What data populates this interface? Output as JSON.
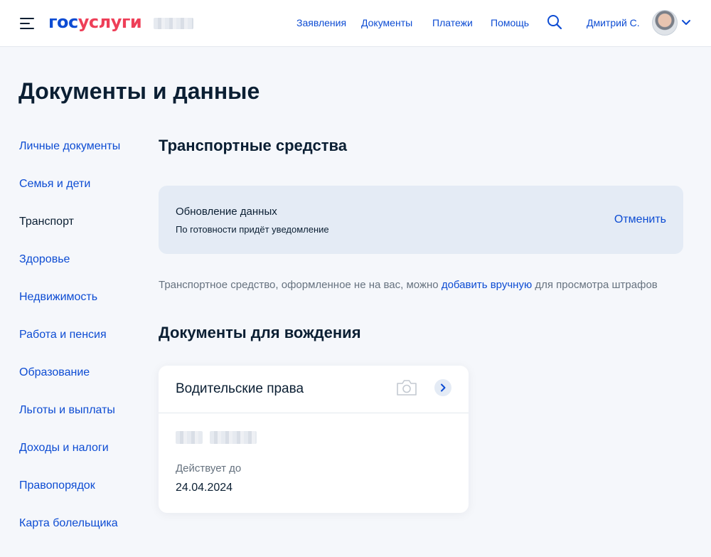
{
  "header": {
    "logo_part1": "гос",
    "logo_part2": "услуги",
    "nav": [
      "Заявления",
      "Документы",
      "Платежи",
      "Помощь"
    ],
    "user_name": "Дмитрий С.",
    "icons": [
      "menu-icon",
      "search-icon",
      "avatar",
      "chevron-down-icon"
    ]
  },
  "page": {
    "title": "Документы и данные"
  },
  "sidebar": {
    "items": [
      {
        "label": "Личные документы"
      },
      {
        "label": "Семья и дети"
      },
      {
        "label": "Транспорт"
      },
      {
        "label": "Здоровье"
      },
      {
        "label": "Недвижимость"
      },
      {
        "label": "Работа и пенсия"
      },
      {
        "label": "Образование"
      },
      {
        "label": "Льготы и выплаты"
      },
      {
        "label": "Доходы и налоги"
      },
      {
        "label": "Правопорядок"
      },
      {
        "label": "Карта болельщика"
      }
    ],
    "active": "Транспорт"
  },
  "transport": {
    "title": "Транспортные средства",
    "banner": {
      "title": "Обновление данных",
      "subtitle": "По готовности придёт уведомление",
      "cancel_label": "Отменить"
    },
    "info_before": "Транспортное средство, оформленное не на вас, можно ",
    "info_link": "добавить вручную",
    "info_after": " для просмотра штрафов"
  },
  "driving": {
    "title": "Документы для вождения",
    "card": {
      "title": "Водительские права",
      "valid_label": "Действует до",
      "valid_date": "24.04.2024"
    }
  },
  "colors": {
    "accent": "#0d4cd3",
    "logo_red": "#ee3f58",
    "text": "#0b1f33",
    "muted": "#66727f",
    "banner_bg": "#e4ebf5",
    "page_bg": "#f5f7fb"
  }
}
